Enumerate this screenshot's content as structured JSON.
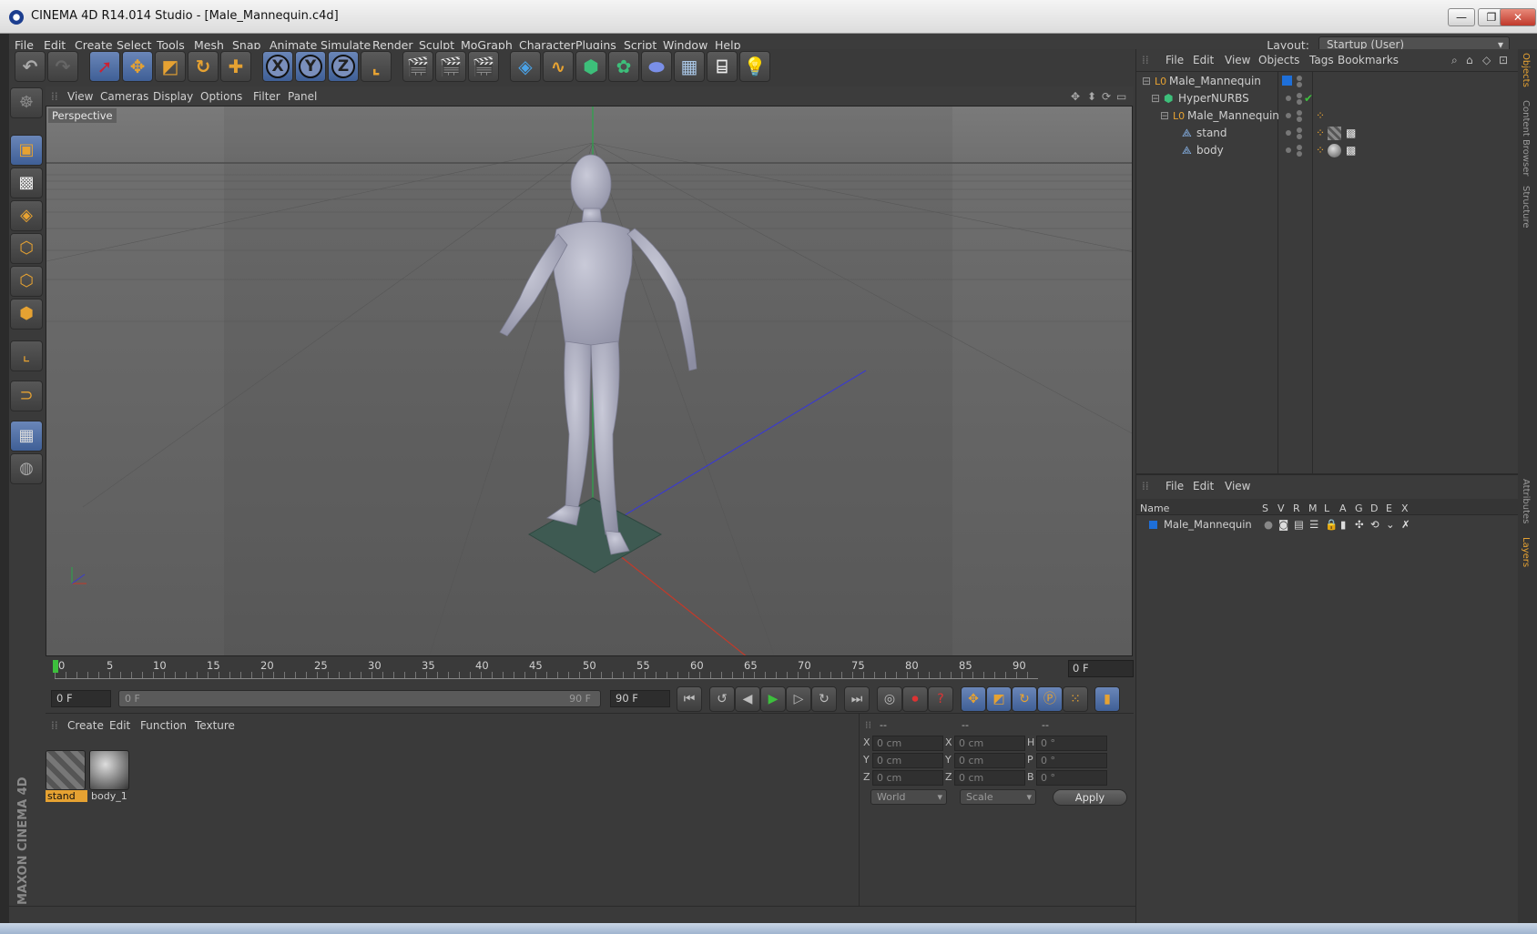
{
  "window": {
    "title": "CINEMA 4D R14.014 Studio - [Male_Mannequin.c4d]",
    "minimize": "—",
    "maximize": "❐",
    "close": "✕"
  },
  "menubar": {
    "items": [
      "File",
      "Edit",
      "Create",
      "Select",
      "Tools",
      "Mesh",
      "Snap",
      "Animate",
      "Simulate",
      "Render",
      "Sculpt",
      "MoGraph",
      "Character",
      "Plugins",
      "Script",
      "Window",
      "Help"
    ],
    "layout_label": "Layout:",
    "layout_value": "Startup (User)"
  },
  "toolbar": {
    "tools": [
      "undo-icon",
      "redo-icon",
      "select-icon",
      "move-icon",
      "scale-icon",
      "rotate-icon",
      "add-icon",
      "x-axis",
      "y-axis",
      "z-axis",
      "coordinate-icon",
      "render-view-icon",
      "render-picture-viewer-icon",
      "render-settings-icon",
      "cube-icon",
      "spline-icon",
      "nurbs-icon",
      "array-icon",
      "deformer-icon",
      "scene-floor-icon",
      "camera-icon",
      "light-icon"
    ],
    "axis_x": "X",
    "axis_y": "Y",
    "axis_z": "Z"
  },
  "viewport": {
    "menu": [
      "View",
      "Cameras",
      "Display",
      "Options",
      "Filter",
      "Panel"
    ],
    "label": "Perspective"
  },
  "timeline": {
    "ticks": [
      "0",
      "5",
      "10",
      "15",
      "20",
      "25",
      "30",
      "35",
      "40",
      "45",
      "50",
      "55",
      "60",
      "65",
      "70",
      "75",
      "80",
      "85",
      "90"
    ],
    "current_frame": "0 F",
    "start_field": "0 F",
    "range_start": "0 F",
    "range_end": "90 F",
    "end_field": "90 F"
  },
  "materials": {
    "menu": [
      "Create",
      "Edit",
      "Function",
      "Texture"
    ],
    "items": [
      {
        "name": "stand",
        "selected": true
      },
      {
        "name": "body_1",
        "selected": false
      }
    ]
  },
  "coordinates": {
    "headers": [
      "--",
      "--",
      "--"
    ],
    "rows": [
      {
        "a": "X",
        "av": "0 cm",
        "b": "X",
        "bv": "0 cm",
        "c": "H",
        "cv": "0 °"
      },
      {
        "a": "Y",
        "av": "0 cm",
        "b": "Y",
        "bv": "0 cm",
        "c": "P",
        "cv": "0 °"
      },
      {
        "a": "Z",
        "av": "0 cm",
        "b": "Z",
        "bv": "0 cm",
        "c": "B",
        "cv": "0 °"
      }
    ],
    "space": "World",
    "mode": "Scale",
    "apply": "Apply"
  },
  "objects": {
    "menu": [
      "File",
      "Edit",
      "View",
      "Objects",
      "Tags",
      "Bookmarks"
    ],
    "tree": [
      {
        "name": "Male_Mannequin",
        "indent": 0,
        "icon": "null-icon"
      },
      {
        "name": "HyperNURBS",
        "indent": 1,
        "icon": "hypernurbs-icon"
      },
      {
        "name": "Male_Mannequin",
        "indent": 2,
        "icon": "null-icon"
      },
      {
        "name": "stand",
        "indent": 3,
        "icon": "polygon-icon"
      },
      {
        "name": "body",
        "indent": 3,
        "icon": "polygon-icon"
      }
    ]
  },
  "layers": {
    "menu": [
      "File",
      "Edit",
      "View"
    ],
    "columns": [
      "Name",
      "S",
      "V",
      "R",
      "M",
      "L",
      "A",
      "G",
      "D",
      "E",
      "X"
    ],
    "rows": [
      {
        "name": "Male_Mannequin",
        "color": "#1e6fd9"
      }
    ]
  },
  "right_tabs": [
    "Objects",
    "Content Browser",
    "Structure",
    "Attributes",
    "Layers"
  ],
  "brand": "MAXON CINEMA 4D",
  "colors": {
    "accent": "#e6a232",
    "selection": "#5b7db8",
    "layer_blue": "#1e6fd9"
  }
}
